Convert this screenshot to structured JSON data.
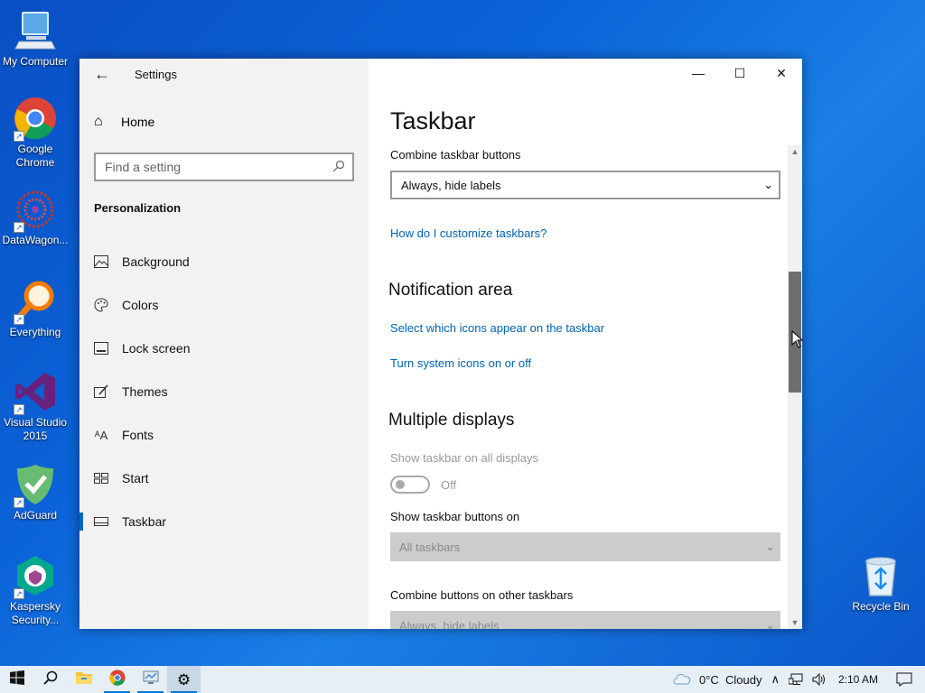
{
  "desktop": {
    "icons": [
      {
        "label": "My Computer",
        "icon": "computer-icon"
      },
      {
        "label": "Google Chrome",
        "icon": "chrome-icon"
      },
      {
        "label": "DataWagon...",
        "icon": "datawagon-icon"
      },
      {
        "label": "Everything",
        "icon": "everything-search-icon"
      },
      {
        "label": "Visual Studio 2015",
        "icon": "visual-studio-icon"
      },
      {
        "label": "AdGuard",
        "icon": "adguard-icon"
      },
      {
        "label": "Kaspersky Security...",
        "icon": "kaspersky-icon"
      },
      {
        "label": "Recycle Bin",
        "icon": "recycle-bin-icon"
      }
    ]
  },
  "window": {
    "title": "Settings",
    "controls": {
      "minimize": "—",
      "maximize": "☐",
      "close": "✕"
    }
  },
  "sidebar": {
    "home_label": "Home",
    "search_placeholder": "Find a setting",
    "section_label": "Personalization",
    "items": [
      {
        "label": "Background",
        "icon": "picture-icon"
      },
      {
        "label": "Colors",
        "icon": "palette-icon"
      },
      {
        "label": "Lock screen",
        "icon": "lock-screen-icon"
      },
      {
        "label": "Themes",
        "icon": "themes-brush-icon"
      },
      {
        "label": "Fonts",
        "icon": "fonts-icon"
      },
      {
        "label": "Start",
        "icon": "start-grid-icon"
      },
      {
        "label": "Taskbar",
        "icon": "taskbar-icon",
        "active": true
      }
    ]
  },
  "main": {
    "title": "Taskbar",
    "combine_label": "Combine taskbar buttons",
    "combine_value": "Always, hide labels",
    "customize_link": "How do I customize taskbars?",
    "notification_heading": "Notification area",
    "select_icons_link": "Select which icons appear on the taskbar",
    "system_icons_link": "Turn system icons on or off",
    "multiple_heading": "Multiple displays",
    "show_all_label": "Show taskbar on all displays",
    "toggle_state": "Off",
    "show_buttons_label": "Show taskbar buttons on",
    "show_buttons_value": "All taskbars",
    "combine_other_label": "Combine buttons on other taskbars",
    "combine_other_value": "Always, hide labels"
  },
  "taskbar": {
    "weather": "0°C  Cloudy",
    "time": "2:10 AM",
    "accent": "#0078d7"
  },
  "colors": {
    "link": "#0063b1",
    "accent": "#0067c0"
  }
}
